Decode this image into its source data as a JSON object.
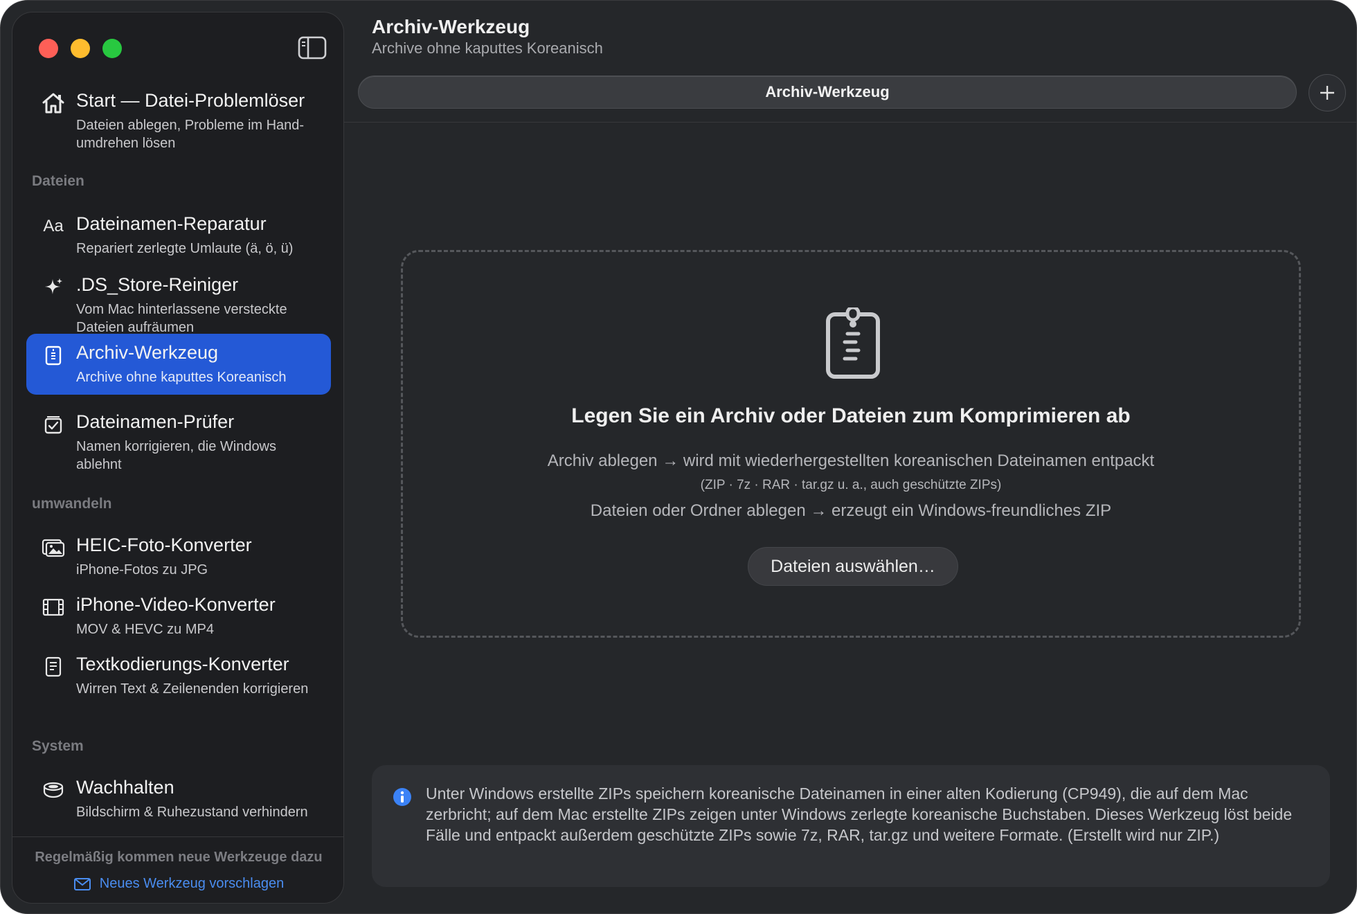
{
  "header": {
    "title": "Archiv-Werkzeug",
    "subtitle": "Archive ohne kaputtes Koreanisch"
  },
  "sidebar": {
    "home": {
      "title": "Start — Datei-Problemlöser",
      "subtitle": "Dateien ablegen, Probleme im Hand-umdrehen lösen",
      "icon": "house-icon"
    },
    "sections": [
      {
        "label": "Dateien",
        "items": [
          {
            "title": "Dateinamen-Reparatur",
            "subtitle": "Repariert zerlegte Umlaute (ä, ö, ü)",
            "icon": "font-aa-icon"
          },
          {
            "title": ".DS_Store-Reiniger",
            "subtitle": "Vom Mac hinterlassene versteckte Dateien aufräumen",
            "icon": "sparkle-icon"
          },
          {
            "title": "Archiv-Werkzeug",
            "subtitle": "Archive ohne kaputtes Koreanisch",
            "icon": "zip-archive-icon",
            "active": true
          },
          {
            "title": "Dateinamen-Prüfer",
            "subtitle": "Namen korrigieren, die Windows ablehnt",
            "icon": "checklist-icon"
          }
        ]
      },
      {
        "label": "umwandeln",
        "items": [
          {
            "title": "HEIC-Foto-Konverter",
            "subtitle": "iPhone-Fotos zu JPG",
            "icon": "photos-icon"
          },
          {
            "title": "iPhone-Video-Konverter",
            "subtitle": "MOV & HEVC zu MP4",
            "icon": "film-icon"
          },
          {
            "title": "Textkodierungs-Konverter",
            "subtitle": "Wirren Text & Zeilenenden korrigieren",
            "icon": "document-icon"
          }
        ]
      },
      {
        "label": "System",
        "items": [
          {
            "title": "Wachhalten",
            "subtitle": "Bildschirm & Ruhezustand verhindern",
            "icon": "coffee-cup-icon"
          }
        ]
      }
    ],
    "footer": {
      "note": "Regelmäßig kommen neue Werkzeuge dazu",
      "link": "Neues Werkzeug vorschlagen"
    }
  },
  "tabs": [
    {
      "label": "Archiv-Werkzeug",
      "active": true
    }
  ],
  "dropzone": {
    "title": "Legen Sie ein Archiv oder Dateien zum Komprimieren ab",
    "line1": "Archiv ablegen → wird mit wiederhergestellten koreanischen Dateinamen entpackt",
    "line2": "(ZIP · 7z · RAR · tar.gz u. a., auch geschützte ZIPs)",
    "line3": "Dateien oder Ordner ablegen → erzeugt ein Windows-freundliches ZIP",
    "button": "Dateien auswählen…"
  },
  "info": {
    "text": "Unter Windows erstellte ZIPs speichern koreanische Dateinamen in einer alten Kodierung (CP949), die auf dem Mac zerbricht; auf dem Mac erstellte ZIPs zeigen unter Windows zerlegte koreanische Buchstaben. Dieses Werkzeug löst beide Fälle und entpackt außerdem geschützte ZIPs sowie 7z, RAR, tar.gz und weitere Formate. (Erstellt wird nur ZIP.)"
  },
  "colors": {
    "accent": "#2459d6",
    "link": "#4a8df0",
    "info": "#3b82f6"
  }
}
